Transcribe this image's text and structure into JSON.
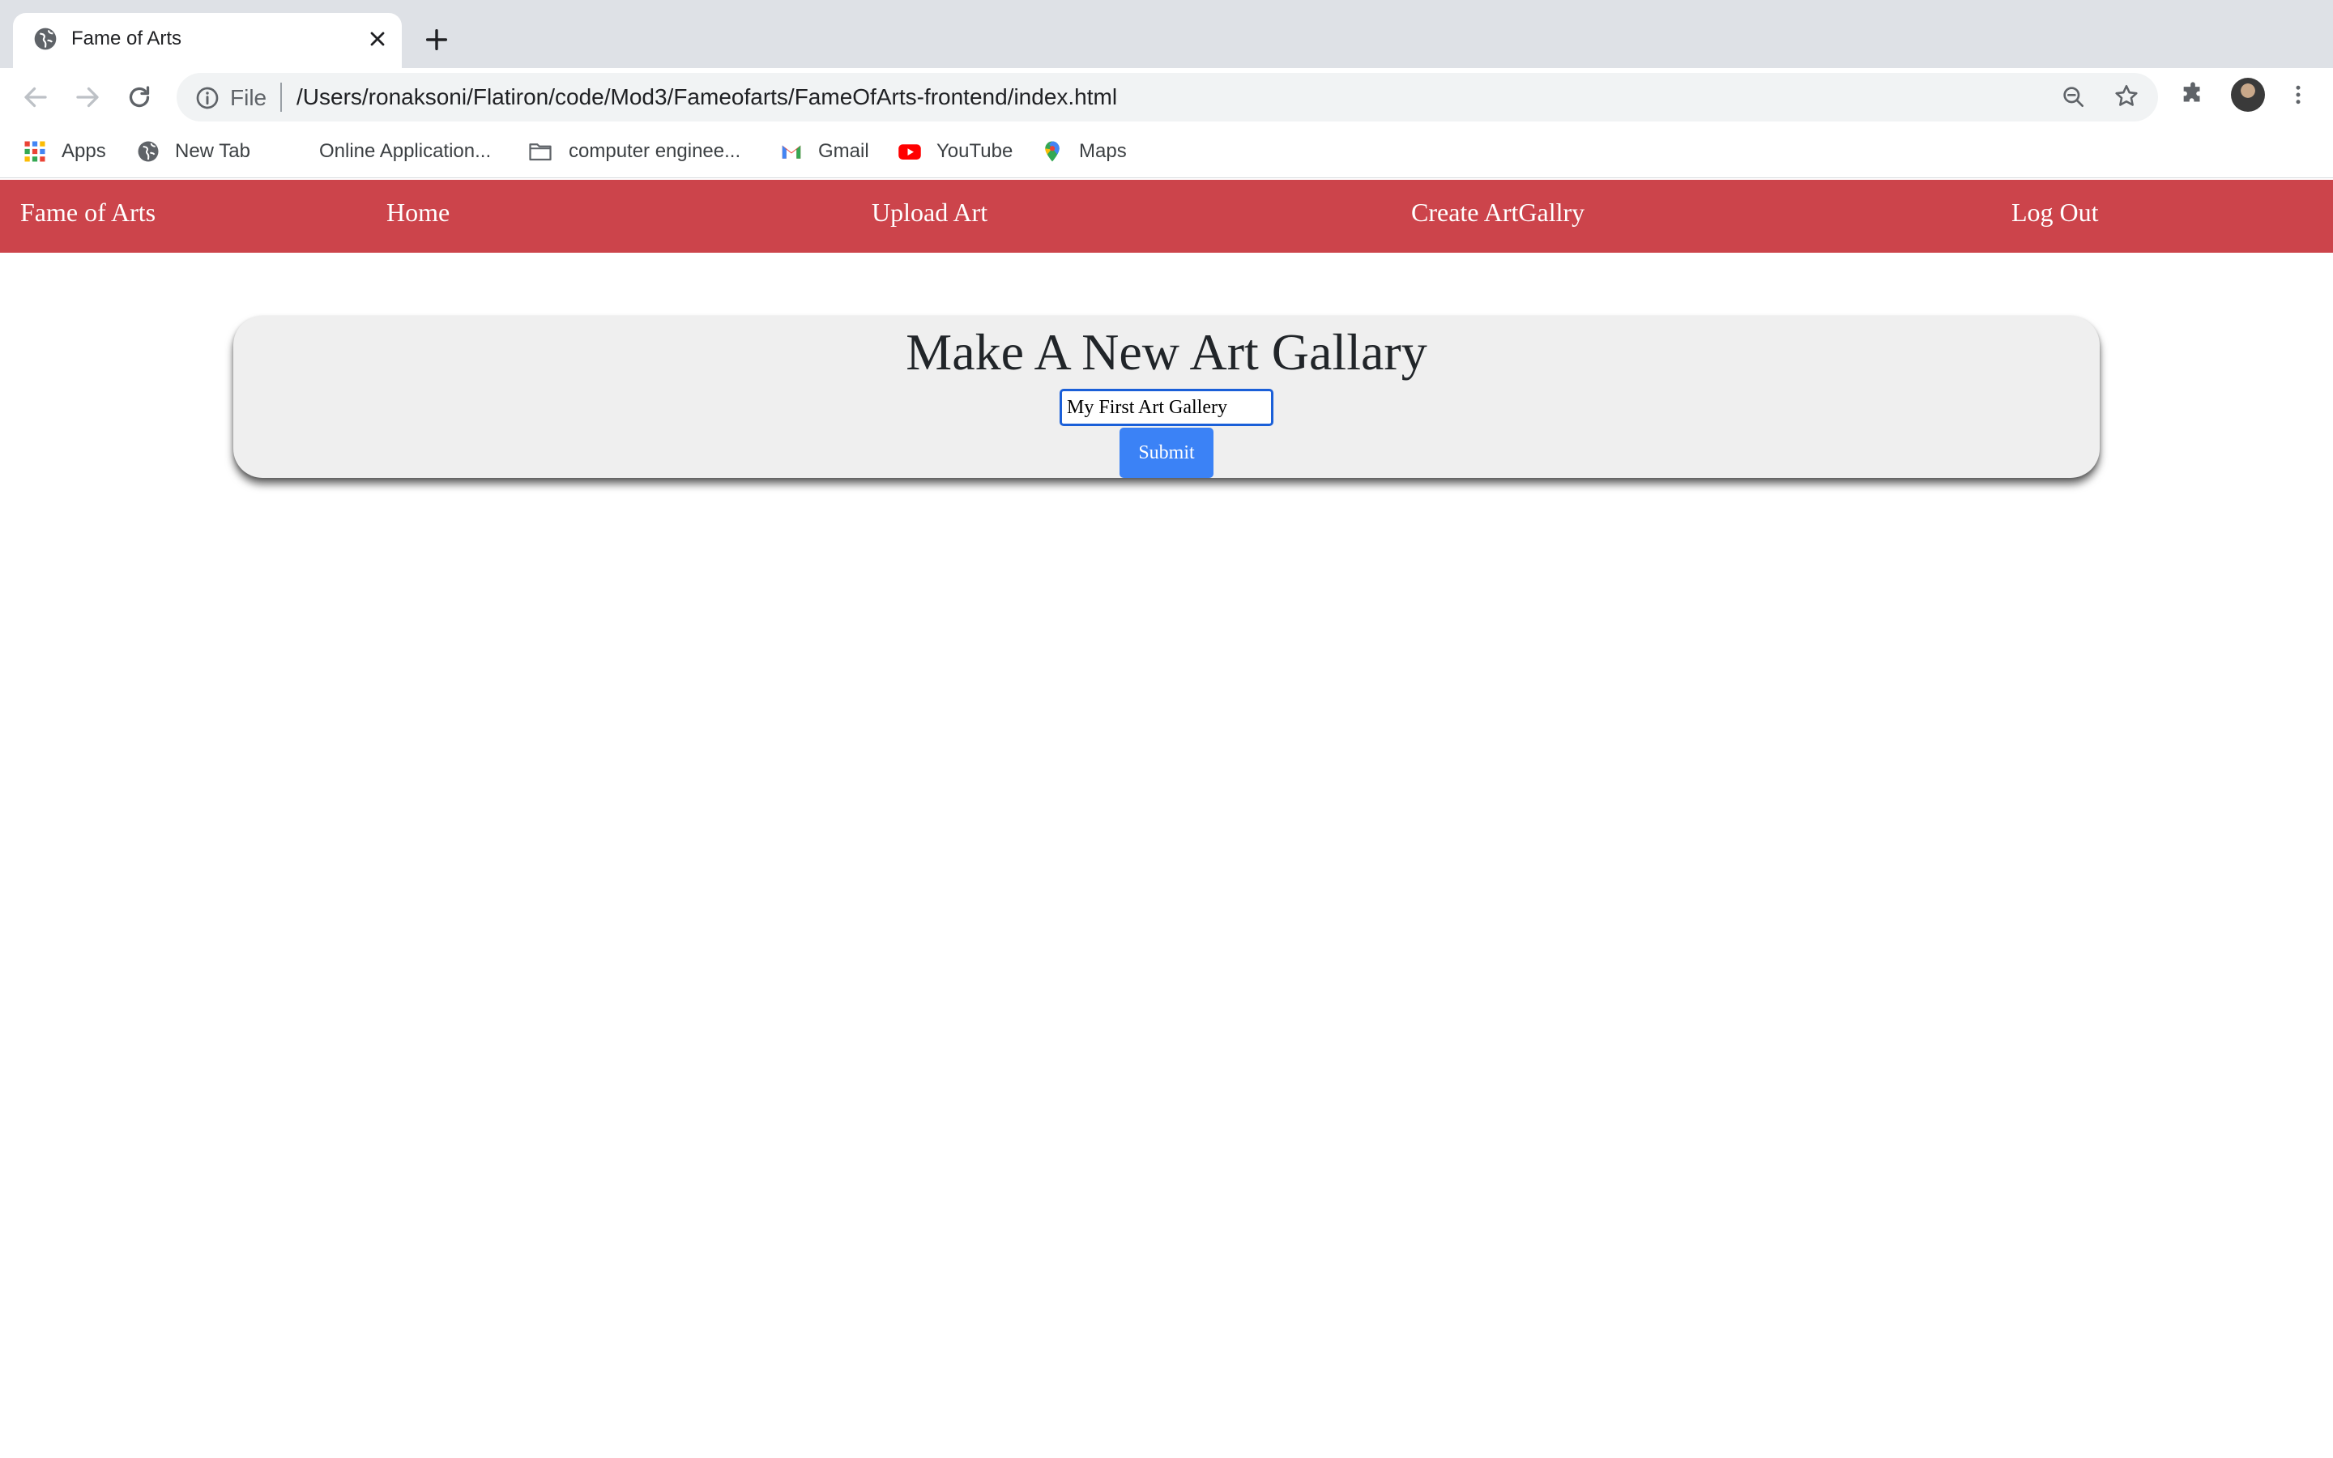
{
  "browser": {
    "tab": {
      "title": "Fame of Arts"
    },
    "address_bar": {
      "scheme_label": "File",
      "url": "/Users/ronaksoni/Flatiron/code/Mod3/Fameofarts/FameOfArts-frontend/index.html"
    },
    "bookmarks": [
      {
        "label": "Apps",
        "icon": "apps-grid-icon"
      },
      {
        "label": "New Tab",
        "icon": "globe-icon"
      },
      {
        "label": "Online Application...",
        "icon": "blank-page-icon"
      },
      {
        "label": "computer enginee...",
        "icon": "folder-icon"
      },
      {
        "label": "Gmail",
        "icon": "gmail-icon"
      },
      {
        "label": "YouTube",
        "icon": "youtube-icon"
      },
      {
        "label": "Maps",
        "icon": "maps-pin-icon"
      }
    ]
  },
  "app": {
    "nav": {
      "brand": "Fame of Arts",
      "home": "Home",
      "upload": "Upload Art",
      "create": "Create ArtGallry",
      "logout": "Log Out"
    },
    "form": {
      "title": "Make A New Art Gallary",
      "input_value": "My First Art Gallery",
      "submit_label": "Submit"
    }
  },
  "colors": {
    "nav_background": "#cc444b",
    "submit_background": "#3b82f6",
    "card_background": "#efefef"
  }
}
